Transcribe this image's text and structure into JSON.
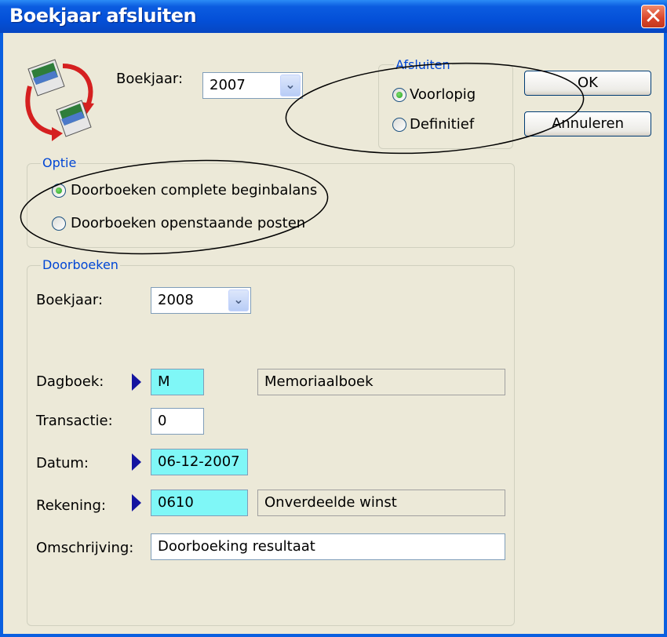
{
  "window": {
    "title": "Boekjaar afsluiten"
  },
  "top": {
    "boekjaar_label": "Boekjaar:",
    "boekjaar_value": "2007",
    "afsluiten": {
      "legend": "Afsluiten",
      "options": [
        {
          "label": "Voorlopig",
          "checked": true
        },
        {
          "label": "Definitief",
          "checked": false
        }
      ]
    }
  },
  "buttons": {
    "ok": "OK",
    "cancel": "Annuleren"
  },
  "optie": {
    "legend": "Optie",
    "options": [
      {
        "label": "Doorboeken complete beginbalans",
        "checked": true
      },
      {
        "label": "Doorboeken openstaande posten",
        "checked": false
      }
    ]
  },
  "doorboeken": {
    "legend": "Doorboeken",
    "boekjaar_label": "Boekjaar:",
    "boekjaar_value": "2008",
    "dagboek_label": "Dagboek:",
    "dagboek_value": "M",
    "dagboek_desc": "Memoriaalboek",
    "transactie_label": "Transactie:",
    "transactie_value": "0",
    "datum_label": "Datum:",
    "datum_value": "06-12-2007",
    "rekening_label": "Rekening:",
    "rekening_value": "0610",
    "rekening_desc": "Onverdeelde winst",
    "omschrijving_label": "Omschrijving:",
    "omschrijving_value": "Doorboeking resultaat"
  },
  "colors": {
    "titlebar": "#0450d8",
    "required_field": "#7ff7f7",
    "legend": "#0046d5",
    "marker": "#1414a0"
  }
}
